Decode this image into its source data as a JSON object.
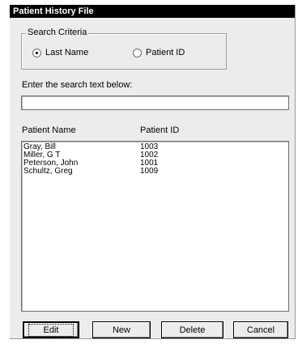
{
  "window": {
    "title": "Patient History File"
  },
  "search_criteria": {
    "legend": "Search Criteria",
    "options": [
      {
        "label": "Last Name",
        "checked": true
      },
      {
        "label": "Patient ID",
        "checked": false
      }
    ]
  },
  "search": {
    "prompt": "Enter the search text below:",
    "value": ""
  },
  "list": {
    "headers": {
      "name": "Patient Name",
      "id": "Patient ID"
    },
    "rows": [
      {
        "name": "Gray, Bill",
        "id": "1003"
      },
      {
        "name": "Miller, G T",
        "id": "1002"
      },
      {
        "name": "Peterson, John",
        "id": "1001"
      },
      {
        "name": "Schultz, Greg",
        "id": "1009"
      }
    ]
  },
  "buttons": {
    "edit": "Edit",
    "new": "New",
    "delete": "Delete",
    "cancel": "Cancel"
  }
}
